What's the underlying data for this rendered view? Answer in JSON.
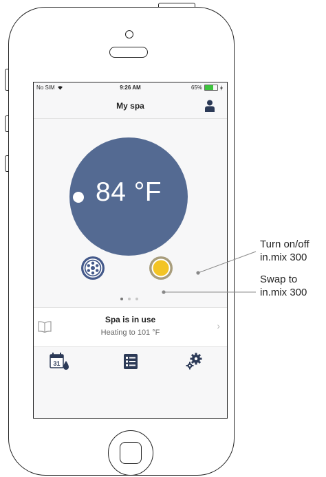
{
  "status_bar": {
    "carrier": "No SIM",
    "time": "9:26 AM",
    "battery_percent": "65%",
    "battery_level": 0.65
  },
  "nav": {
    "title": "My spa"
  },
  "thermo": {
    "temperature": "84 °F"
  },
  "pager": {
    "count": 3,
    "active_index": 0
  },
  "spa_status": {
    "title": "Spa is in use",
    "subtitle": "Heating to 101 °F"
  },
  "tabs": {
    "calendar_day": "31",
    "items": [
      "calendar-icon",
      "list-icon",
      "settings-icon"
    ]
  },
  "annotations": {
    "turn_on_off": [
      "Turn on/off",
      "in.mix 300"
    ],
    "swap_to": [
      "Swap to",
      "in.mix 300"
    ]
  },
  "colors": {
    "thermo_circle": "#546a92",
    "light_yellow": "#f3c425",
    "icon_blue": "#44598a",
    "battery_green": "#3ec33e"
  }
}
